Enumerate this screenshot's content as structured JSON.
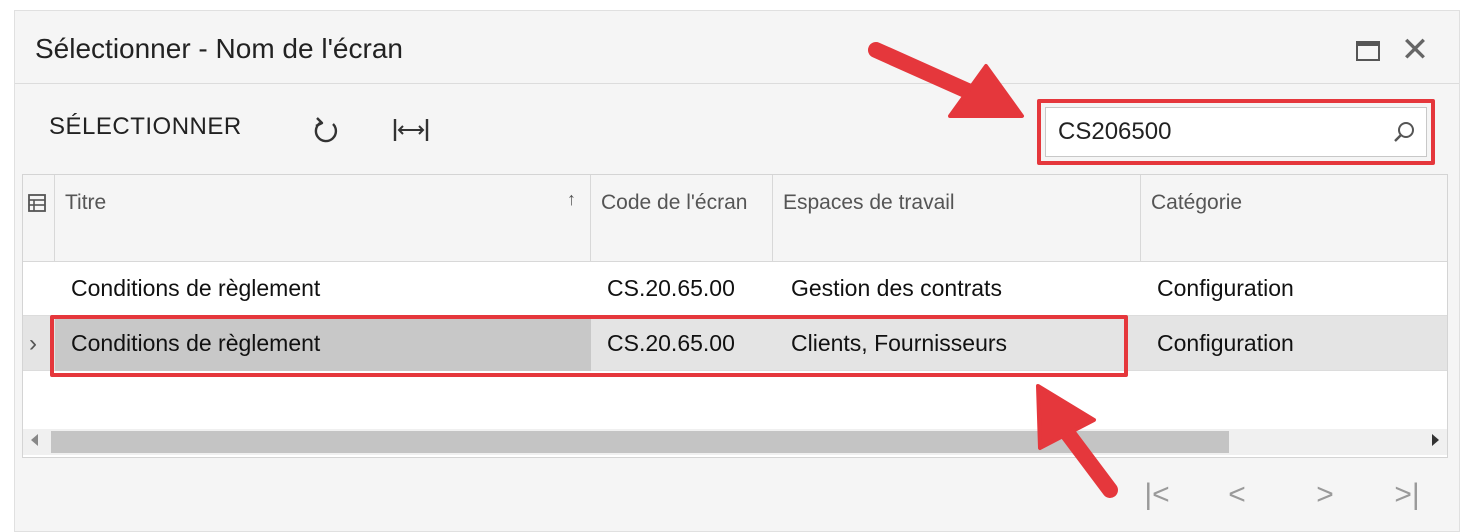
{
  "dialog": {
    "title": "Sélectionner - Nom de l'écran"
  },
  "toolbar": {
    "select_label": "SÉLECTIONNER",
    "refresh_icon": "refresh-icon",
    "fit_columns_icon": "fit-columns-icon"
  },
  "search": {
    "value": "CS206500",
    "icon": "search-icon"
  },
  "grid": {
    "columns": [
      {
        "label": "Titre"
      },
      {
        "label": "Code de l'écran"
      },
      {
        "label": "Espaces de travail"
      },
      {
        "label": "Catégorie"
      }
    ],
    "rows": [
      {
        "title": "Conditions de règlement",
        "code": "CS.20.65.00",
        "workspaces": "Gestion des contrats",
        "category": "Configuration",
        "selected": false
      },
      {
        "title": "Conditions de règlement",
        "code": "CS.20.65.00",
        "workspaces": "Clients, Fournisseurs",
        "category": "Configuration",
        "selected": true
      }
    ]
  },
  "pager": {
    "first": "|<",
    "prev": "<",
    "next": ">",
    "last": ">|"
  },
  "colors": {
    "highlight": "#e5373c",
    "selected_row": "#e4e4e4"
  }
}
